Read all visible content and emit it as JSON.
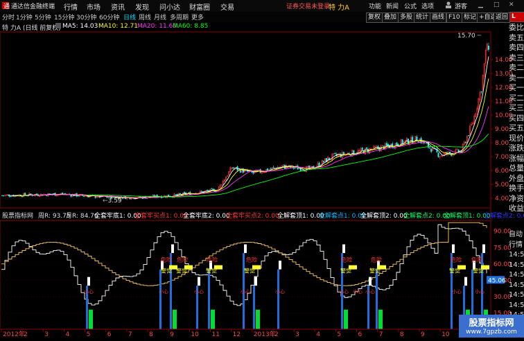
{
  "app": {
    "title": "通达信金融终端",
    "menu": [
      "行情",
      "市场",
      "资讯",
      "发现",
      "问小达",
      "财富圈",
      "交易"
    ],
    "login_notice": "证券交易未登录",
    "stock_name": "特 力A",
    "right_menu": [
      "功能",
      "新闻",
      "公式",
      "选项",
      "游客"
    ]
  },
  "timeframes": [
    "分时",
    "1分钟",
    "5分钟",
    "15分钟",
    "30分钟",
    "60分钟",
    "日线",
    "周线",
    "月线",
    "多周期",
    "更多"
  ],
  "active_timeframe": "日线",
  "toolbar": [
    "复权",
    "叠加",
    "多股",
    "统计",
    "画线",
    "F10",
    "标记",
    "+自选",
    "返回"
  ],
  "ma_bar": {
    "title": "特 力A (日线 前复权)",
    "ma5": "MA5: 14.03",
    "ma10": "MA10: 12.71",
    "ma20": "MA20: 11.60",
    "ma60": "MA60: 8.85"
  },
  "price_labels": {
    "high": "15.70",
    "low": "3.59"
  },
  "price_axis": [
    "14.00",
    "13.00",
    "12.00",
    "11.00",
    "10.00",
    "9.00",
    "8.00",
    "7.00",
    "6.00",
    "5.00",
    "4.00"
  ],
  "indicator_bar": {
    "name": "股票指标网",
    "week": "周R: 93.75",
    "month": "月R: 84.76",
    "items": [
      {
        "text": "全套牢底1: 0.00",
        "color": "#ffffff"
      },
      {
        "text": "全套牢买点1: 0.00",
        "color": "#ff3333"
      },
      {
        "text": "全套牢底2: 0.00",
        "color": "#ffffff"
      },
      {
        "text": "全套牢买点2: 0.00",
        "color": "#ff3333"
      },
      {
        "text": "全解套顶1: 0.00",
        "color": "#ffffff"
      },
      {
        "text": "全解套点1: 0.00",
        "color": "#00bbff"
      },
      {
        "text": "全解套顶2: 0.00",
        "color": "#ffffff"
      },
      {
        "text": "全解套点2: 0.00",
        "color": "#00ff66"
      },
      {
        "text": "全解套顶1: 0.00",
        "color": "#00ff66"
      },
      {
        "text": "全解套点2: 0.00",
        "color": "#3333ff"
      }
    ]
  },
  "indicator_axis": [
    "90.00",
    "75.00",
    "60.00",
    "45.00",
    "30.00",
    "15.00"
  ],
  "indicator_tag": "45.06",
  "signal_labels": {
    "danger": "危险",
    "alert": "警觉",
    "caution": "小心"
  },
  "date_axis": [
    "2012年",
    "2",
    "3",
    "4",
    "5",
    "6",
    "7",
    "8",
    "9",
    "10",
    "11",
    "12",
    "2013年",
    "2",
    "3",
    "4",
    "5",
    "6",
    "7",
    "8",
    "9",
    "10",
    "11"
  ],
  "right_panel_top": [
    "委比",
    "卖五",
    "卖四",
    "卖三",
    "卖二",
    "卖一",
    "买一",
    "买二",
    "买三",
    "买四",
    "买五",
    "现价",
    "涨跌",
    "涨幅",
    "总量",
    "外盘",
    "换手",
    "净资",
    "收益"
  ],
  "right_panel_bottom": [
    "自动",
    "行情",
    "14:50",
    "14:50",
    "14:50",
    "14:50",
    "14:50",
    "14:50",
    "14:50",
    "14:50",
    "14:50"
  ],
  "watermark": {
    "title": "股票指标网",
    "url": "www.7gpzb.com"
  },
  "colors": {
    "ma5": "#ffffff",
    "ma10": "#ffff00",
    "ma20": "#ff33ff",
    "ma60": "#00ff00",
    "up": "#ff3333",
    "down": "#00ffff",
    "bg": "#000000"
  }
}
